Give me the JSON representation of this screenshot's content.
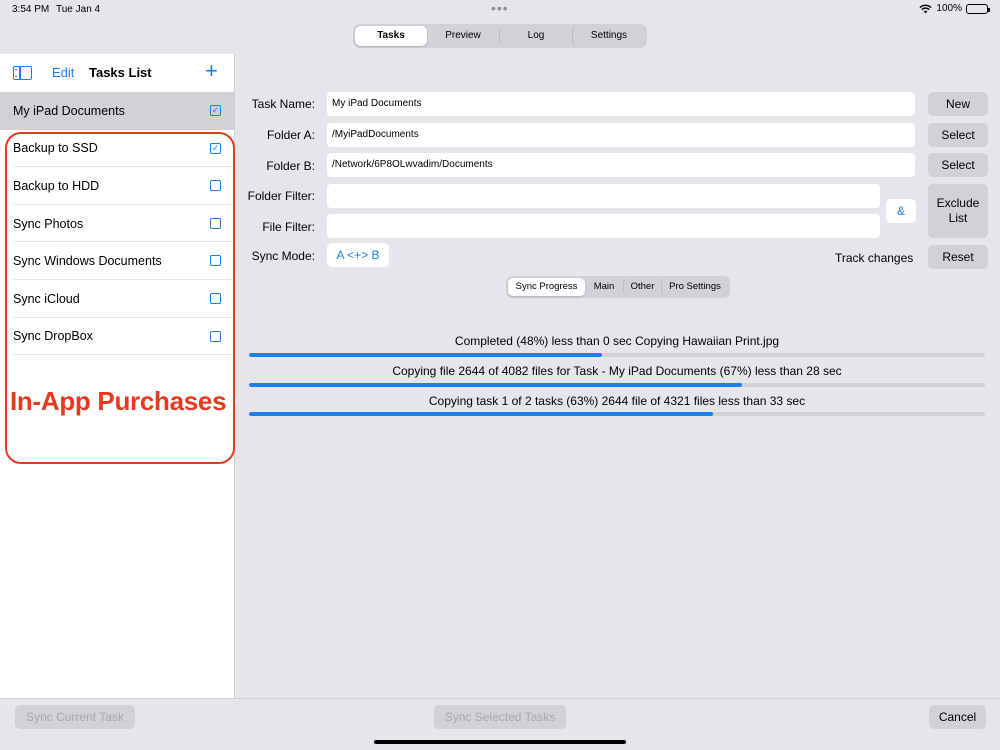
{
  "status": {
    "time": "3:54 PM",
    "date": "Tue Jan 4",
    "battery": "100%"
  },
  "top_tabs": [
    {
      "label": "Tasks",
      "active": true
    },
    {
      "label": "Preview",
      "active": false
    },
    {
      "label": "Log",
      "active": false
    },
    {
      "label": "Settings",
      "active": false
    }
  ],
  "sidebar": {
    "edit_label": "Edit",
    "title": "Tasks List",
    "add_symbol": "+",
    "tasks": [
      {
        "label": "My iPad Documents",
        "checked": true,
        "selected": true
      },
      {
        "label": "Backup to SSD",
        "checked": true,
        "selected": false
      },
      {
        "label": "Backup to HDD",
        "checked": false,
        "selected": false
      },
      {
        "label": "Sync Photos",
        "checked": false,
        "selected": false
      },
      {
        "label": "Sync Windows Documents",
        "checked": false,
        "selected": false
      },
      {
        "label": "Sync iCloud",
        "checked": false,
        "selected": false
      },
      {
        "label": "Sync DropBox",
        "checked": false,
        "selected": false
      }
    ],
    "annotation": "In-App Purchases"
  },
  "form": {
    "task_name_label": "Task Name:",
    "task_name_value": "My iPad Documents",
    "folder_a_label": "Folder A:",
    "folder_a_value": "/MyiPadDocuments",
    "folder_b_label": "Folder B:",
    "folder_b_value": "/Network/6P8OLwvadim/Documents",
    "folder_filter_label": "Folder Filter:",
    "folder_filter_value": "",
    "file_filter_label": "File Filter:",
    "file_filter_value": "",
    "sync_mode_label": "Sync Mode:",
    "sync_mode_value": "A <+> B",
    "track_changes_label": "Track changes",
    "new_button": "New",
    "select_a_button": "Select",
    "select_b_button": "Select",
    "and_button": "&",
    "exclude_line1": "Exclude",
    "exclude_line2": "List",
    "reset_button": "Reset"
  },
  "sub_tabs": [
    {
      "label": "Sync Progress",
      "active": true
    },
    {
      "label": "Main",
      "active": false
    },
    {
      "label": "Other",
      "active": false
    },
    {
      "label": "Pro Settings",
      "active": false
    }
  ],
  "progress": [
    {
      "text": "Completed (48%) less than 0 sec Copying Hawaiian Print.jpg",
      "fraction": 0.48
    },
    {
      "text": "Copying file 2644 of 4082 files for Task - My iPad Documents (67%) less than 28 sec",
      "fraction": 0.67
    },
    {
      "text": "Copying task 1 of 2 tasks (63%) 2644 file of 4321 files less than 33 sec",
      "fraction": 0.63
    }
  ],
  "bottom": {
    "sync_current": "Sync Current Task",
    "sync_selected": "Sync Selected Tasks",
    "cancel": "Cancel"
  },
  "colors": {
    "accent": "#1a7ff0",
    "annotation": "#e53a20"
  }
}
